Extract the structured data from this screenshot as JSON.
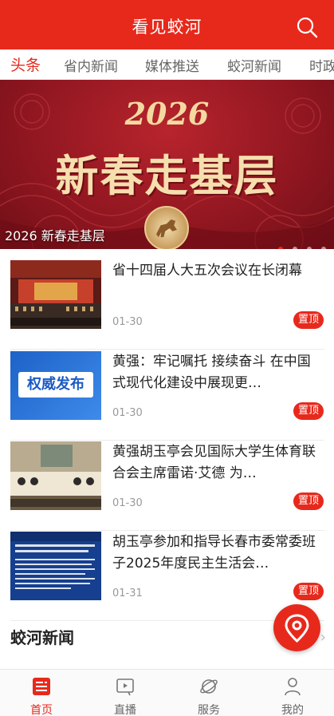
{
  "header": {
    "title": "看见蛟河"
  },
  "tabs": [
    {
      "label": "头条",
      "active": true
    },
    {
      "label": "省内新闻"
    },
    {
      "label": "媒体推送"
    },
    {
      "label": "蛟河新闻"
    },
    {
      "label": "时政"
    }
  ],
  "banner": {
    "year": "2026",
    "slogan": "新春走基层",
    "caption": "2026 新春走基层",
    "slide_count": 4,
    "active_slide": 1
  },
  "news": [
    {
      "headline": "省十四届人大五次会议在长闭幕",
      "date": "01-30",
      "badge": "置顶",
      "thumb_caption": "省十四届人大五次会议在长闭幕"
    },
    {
      "headline": "黄强：牢记嘱托 接续奋斗 在中国式现代化建设中展现更…",
      "date": "01-30",
      "badge": "置顶",
      "thumb_text": "权威发布"
    },
    {
      "headline": "黄强胡玉亭会见国际大学生体育联合会主席雷诺·艾德 为…",
      "date": "01-30",
      "badge": "置顶",
      "thumb_caption": "黄强胡玉亭会见国际大学生体育联合会主席雷诺·艾德"
    },
    {
      "headline": "胡玉亭参加和指导长春市委常委班子2025年度民主生活会…",
      "date": "01-31",
      "badge": "置顶"
    }
  ],
  "section": {
    "title": "蛟河新闻"
  },
  "bottom_nav": [
    {
      "label": "首页",
      "icon": "news-icon",
      "active": true
    },
    {
      "label": "直播",
      "icon": "video-icon"
    },
    {
      "label": "服务",
      "icon": "planet-icon"
    },
    {
      "label": "我的",
      "icon": "user-icon"
    }
  ],
  "colors": {
    "accent": "#e7291c",
    "banner": "#8f1620",
    "text": "#222222",
    "muted": "#999999"
  }
}
